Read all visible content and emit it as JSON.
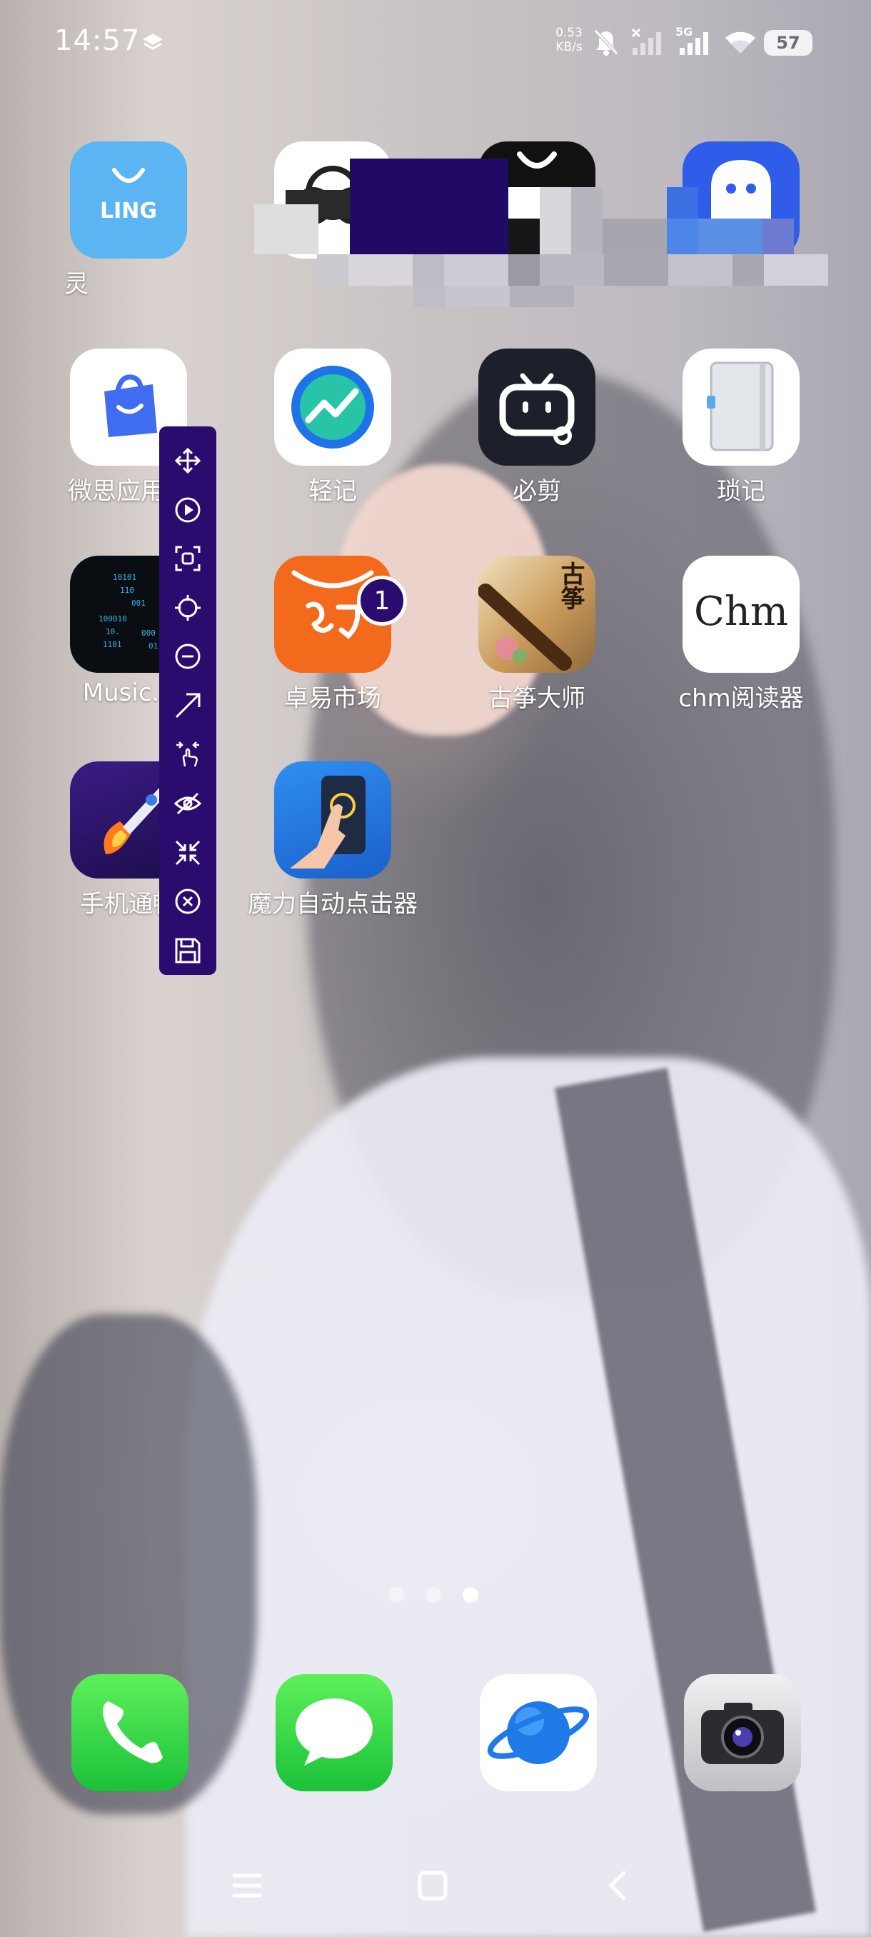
{
  "status_bar": {
    "time": "14:57",
    "net_speed_value": "0.53",
    "net_speed_unit": "KB/s",
    "network_type": "5G",
    "battery": "57"
  },
  "apps": {
    "ling": {
      "tile_text": "LING",
      "label": "灵"
    },
    "weisi": {
      "label": "微思应用市"
    },
    "qingji": {
      "label": "轻记"
    },
    "bijian": {
      "label": "必剪"
    },
    "suoji": {
      "label": "琐记"
    },
    "music": {
      "label": "Music.a"
    },
    "zhuoyi": {
      "label": "卓易市场",
      "badge": "1"
    },
    "guzheng": {
      "label": "古筝大师",
      "tile_text": "古筝"
    },
    "chm": {
      "label": "chm阅读器",
      "tile_text": "Chm"
    },
    "booster": {
      "label": "手机通畅"
    },
    "autoclicker": {
      "label": "魔力自动点击器"
    }
  },
  "toolbar": {
    "buttons": [
      "move-icon",
      "play-icon",
      "screenshot-icon",
      "target-icon",
      "remove-icon",
      "swipe-arrow-icon",
      "multi-touch-icon",
      "hide-icon",
      "collapse-icon",
      "close-icon",
      "save-icon"
    ]
  },
  "page_indicator": {
    "count": 3,
    "active": 3
  },
  "dock": [
    "phone",
    "messages",
    "browser",
    "camera"
  ],
  "colors": {
    "toolbar_bg": "#2a0b6e",
    "badge_bg": "#2a0b6e"
  }
}
